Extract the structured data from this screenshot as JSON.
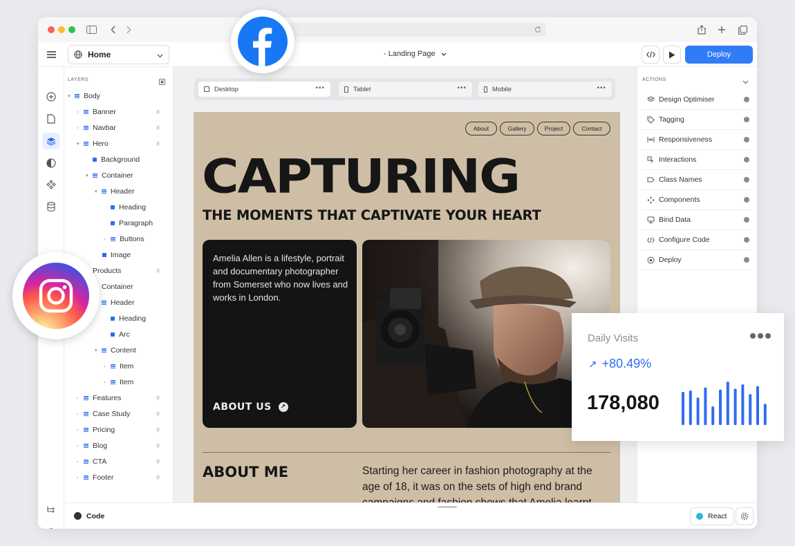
{
  "toolbar": {
    "home_label": "Home",
    "page_title": "- Landing Page",
    "deploy_label": "Deploy"
  },
  "layers": {
    "title": "LAYERS",
    "items": [
      {
        "label": "Body"
      },
      {
        "label": "Banner"
      },
      {
        "label": "Navbar"
      },
      {
        "label": "Hero"
      },
      {
        "label": "Background"
      },
      {
        "label": "Container"
      },
      {
        "label": "Header"
      },
      {
        "label": "Heading"
      },
      {
        "label": "Paragraph"
      },
      {
        "label": "Buttons"
      },
      {
        "label": "Image"
      },
      {
        "label": "Products"
      },
      {
        "label": "Container"
      },
      {
        "label": "Header"
      },
      {
        "label": "Heading"
      },
      {
        "label": "Arc"
      },
      {
        "label": "Content"
      },
      {
        "label": "Item"
      },
      {
        "label": "Item"
      },
      {
        "label": "Features"
      },
      {
        "label": "Case Study"
      },
      {
        "label": "Pricing"
      },
      {
        "label": "Blog"
      },
      {
        "label": "CTA"
      },
      {
        "label": "Footer"
      }
    ]
  },
  "devices": [
    {
      "label": "Desktop"
    },
    {
      "label": "Tablet"
    },
    {
      "label": "Mobile"
    }
  ],
  "site": {
    "nav": [
      "About",
      "Gallery",
      "Project",
      "Contact"
    ],
    "hero_title": "CAPTURING",
    "hero_subtitle": "THE MOMENTS THAT CAPTIVATE YOUR HEART",
    "intro": "Amelia Allen is a lifestyle, portrait and documentary photographer from Somerset who now lives and works in London.",
    "about_link": "ABOUT US",
    "about_heading": "ABOUT ME",
    "about_text": "Starting her career in fashion photography at the age of 18, it was on the sets of high end brand campaigns and fashion shows that Amelia learnt"
  },
  "actions": {
    "title": "ACTIONS",
    "items": [
      {
        "label": "Design Optimiser",
        "icon": "layers-icon"
      },
      {
        "label": "Tagging",
        "icon": "tag-icon"
      },
      {
        "label": "Responsiveness",
        "icon": "responsive-icon"
      },
      {
        "label": "Interactions",
        "icon": "interactions-icon"
      },
      {
        "label": "Class Names",
        "icon": "class-names-icon"
      },
      {
        "label": "Components",
        "icon": "components-icon"
      },
      {
        "label": "Bind Data",
        "icon": "bind-data-icon"
      },
      {
        "label": "Configure Code",
        "icon": "code-icon"
      },
      {
        "label": "Deploy",
        "icon": "deploy-icon"
      }
    ]
  },
  "bottom": {
    "code_label": "Code",
    "framework_label": "React"
  },
  "visits_card": {
    "title": "Daily Visits",
    "change": "+80.49%",
    "value": "178,080",
    "bar_levels": [
      0.75,
      0.78,
      0.62,
      0.85,
      0.42,
      0.8,
      0.98,
      0.82,
      0.92,
      0.7,
      0.88,
      0.48
    ],
    "accent": "#2f6cf0"
  },
  "colors": {
    "deploy": "#2f7cf6",
    "site_background": "#cfbea6",
    "facebook": "#1877f2"
  }
}
